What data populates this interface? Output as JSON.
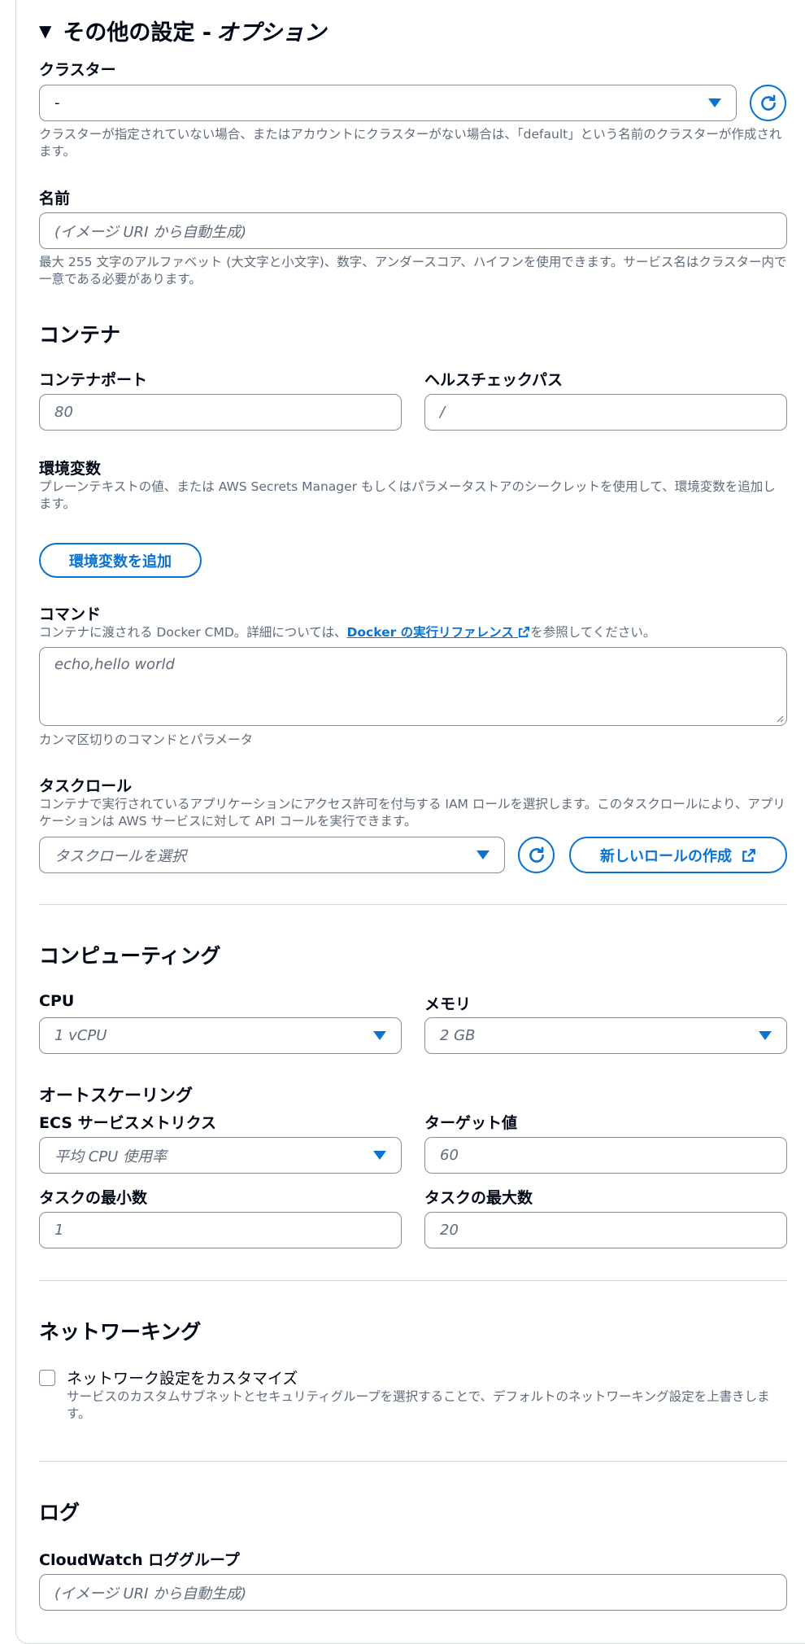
{
  "header": {
    "title": "その他の設定 -",
    "optional": "オプション"
  },
  "cluster": {
    "label": "クラスター",
    "value": "-",
    "description": "クラスターが指定されていない場合、またはアカウントにクラスターがない場合は、「default」という名前のクラスターが作成されます。"
  },
  "name": {
    "label": "名前",
    "placeholder": "(イメージ URI から自動生成)",
    "description": "最大 255 文字のアルファベット (大文字と小文字)、数字、アンダースコア、ハイフンを使用できます。サービス名はクラスター内で一意である必要があります。"
  },
  "container": {
    "heading": "コンテナ",
    "port_label": "コンテナポート",
    "port_placeholder": "80",
    "health_label": "ヘルスチェックパス",
    "health_placeholder": "/"
  },
  "env": {
    "label": "環境変数",
    "description": "プレーンテキストの値、または AWS Secrets Manager もしくはパラメータストアのシークレットを使用して、環境変数を追加します。",
    "add_button": "環境変数を追加"
  },
  "command": {
    "label": "コマンド",
    "desc_prefix": "コンテナに渡される Docker CMD。詳細については、",
    "desc_link": "Docker の実行リファレンス",
    "desc_suffix": "を参照してください。",
    "placeholder": "echo,hello world",
    "hint": "カンマ区切りのコマンドとパラメータ"
  },
  "task_role": {
    "label": "タスクロール",
    "description": "コンテナで実行されているアプリケーションにアクセス許可を付与する IAM ロールを選択します。このタスクロールにより、アプリケーションは AWS サービスに対して API コールを実行できます。",
    "placeholder": "タスクロールを選択",
    "create_button": "新しいロールの作成"
  },
  "compute": {
    "heading": "コンピューティング",
    "cpu_label": "CPU",
    "cpu_value": "1 vCPU",
    "memory_label": "メモリ",
    "memory_value": "2 GB"
  },
  "autoscaling": {
    "heading": "オートスケーリング",
    "metric_label": "ECS サービスメトリクス",
    "metric_placeholder": "平均 CPU 使用率",
    "target_label": "ターゲット値",
    "target_placeholder": "60",
    "min_label": "タスクの最小数",
    "min_placeholder": "1",
    "max_label": "タスクの最大数",
    "max_placeholder": "20"
  },
  "networking": {
    "heading": "ネットワーキング",
    "checkbox_label": "ネットワーク設定をカスタマイズ",
    "checkbox_desc": "サービスのカスタムサブネットとセキュリティグループを選択することで、デフォルトのネットワーキング設定を上書きします。"
  },
  "logs": {
    "heading": "ログ",
    "group_label": "CloudWatch ロググループ",
    "group_placeholder": "(イメージ URI から自動生成)"
  },
  "colors": {
    "accent": "#0972d3",
    "border": "#8c8c94",
    "muted_text": "#5f6b7a",
    "divider": "#d5dbdb"
  }
}
